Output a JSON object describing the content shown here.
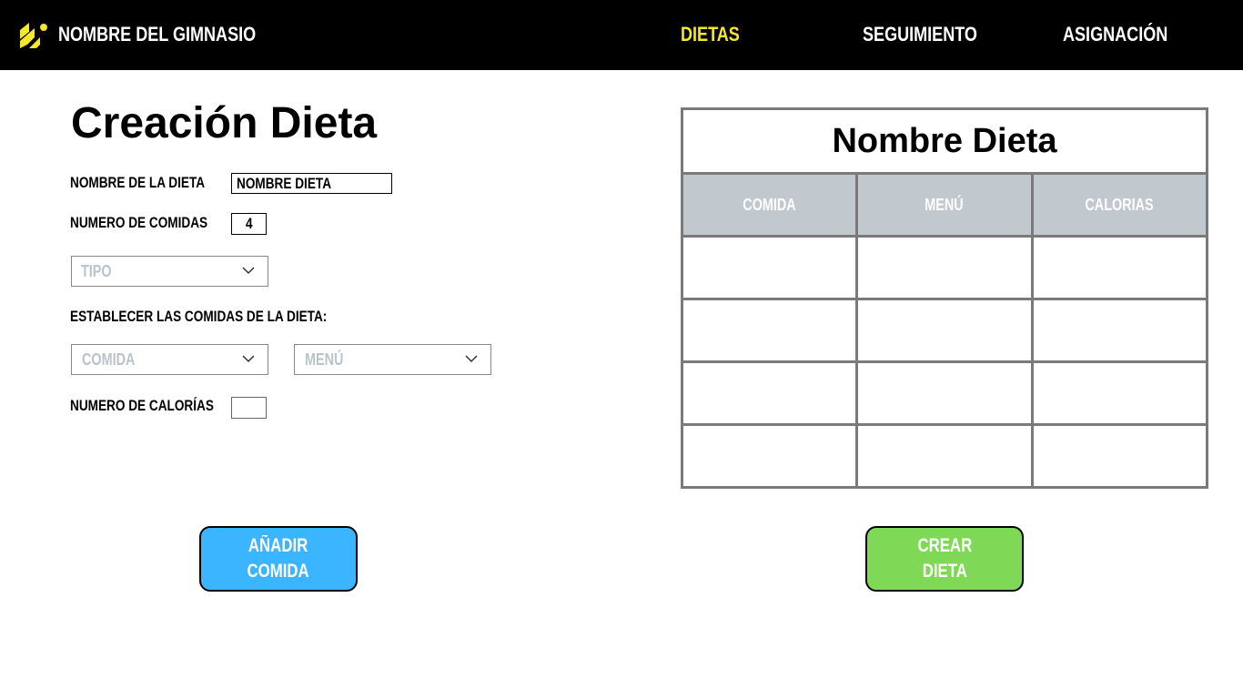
{
  "header": {
    "brand": "NOMBRE DEL GIMNASIO",
    "nav": [
      {
        "label": "DIETAS",
        "active": true
      },
      {
        "label": "SEGUIMIENTO",
        "active": false
      },
      {
        "label": "ASIGNACIÓN",
        "active": false
      }
    ],
    "logo_icon": "lightning-stripes-logo-icon",
    "accent_color": "#f5e72a"
  },
  "form": {
    "title": "Creación Dieta",
    "diet_name_label": "NOMBRE DE LA DIETA",
    "diet_name_value": "NOMBRE DIETA",
    "meal_count_label": "NUMERO DE COMIDAS",
    "meal_count_value": "4",
    "type_placeholder": "TIPO",
    "set_meals_label": "ESTABLECER LAS COMIDAS DE LA DIETA:",
    "meal_placeholder": "COMIDA",
    "menu_placeholder": "MENÚ",
    "calories_label": "NUMERO DE CALORÍAS",
    "calories_value": ""
  },
  "buttons": {
    "add_meal": "AÑADIR\nCOMIDA",
    "add_meal_color": "#3bb5ff",
    "create_diet": "CREAR\nDIETA",
    "create_diet_color": "#7fd957"
  },
  "table": {
    "title": "Nombre Dieta",
    "columns": [
      "COMIDA",
      "MENÚ",
      "CALORIAS"
    ],
    "rows": [
      [
        "",
        "",
        ""
      ],
      [
        "",
        "",
        ""
      ],
      [
        "",
        "",
        ""
      ],
      [
        "",
        "",
        ""
      ]
    ]
  }
}
